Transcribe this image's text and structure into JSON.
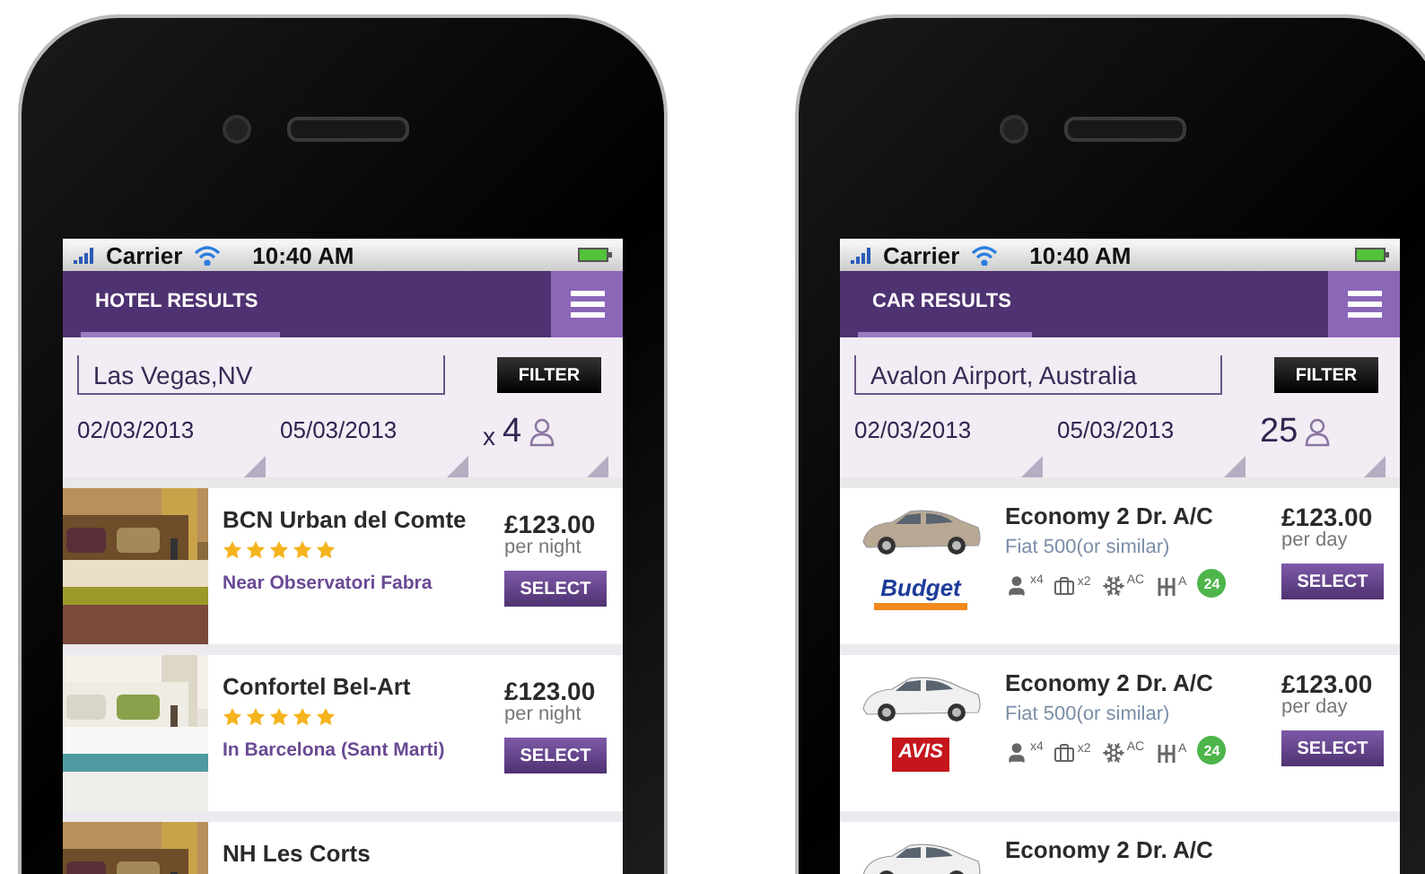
{
  "phones": [
    {
      "status_bar": {
        "carrier": "Carrier",
        "time": "10:40 AM"
      },
      "tab": {
        "label": "HOTEL RESULTS",
        "selected": true
      },
      "search": {
        "value": "Las Vegas,NV"
      },
      "filter_button": "FILTER",
      "dates": [
        "02/03/2013",
        "05/03/2013"
      ],
      "guests": {
        "prefix": "x",
        "count": "4"
      },
      "results": [
        {
          "kind": "hotel",
          "name": "BCN Urban del Comte",
          "stars": 5,
          "location": "Near Observatori Fabra",
          "price": "£123.00",
          "unit": "per night",
          "button": "SELECT"
        },
        {
          "kind": "hotel",
          "name": "Confortel Bel-Art",
          "stars": 5,
          "location": "In Barcelona (Sant Marti)",
          "price": "£123.00",
          "unit": "per night",
          "button": "SELECT"
        },
        {
          "kind": "hotel",
          "name": "NH Les Corts"
        }
      ]
    },
    {
      "status_bar": {
        "carrier": "Carrier",
        "time": "10:40 AM"
      },
      "tab": {
        "label": "CAR RESULTS",
        "selected": true
      },
      "search": {
        "value": "Avalon Airport, Australia"
      },
      "filter_button": "FILTER",
      "dates": [
        "02/03/2013",
        "05/03/2013"
      ],
      "guests": {
        "count": "25"
      },
      "results": [
        {
          "kind": "car",
          "name": "Economy 2 Dr. A/C",
          "model": "Fiat 500(or similar)",
          "logo": {
            "kind": "budget",
            "text": "Budget"
          },
          "features": [
            {
              "kind": "person",
              "label": "x4"
            },
            {
              "kind": "bag",
              "label": "x2"
            },
            {
              "kind": "ac",
              "label": "AC"
            },
            {
              "kind": "gear",
              "label": "A"
            }
          ],
          "badge": "24",
          "price": "£123.00",
          "unit": "per day",
          "button": "SELECT"
        },
        {
          "kind": "car",
          "name": "Economy 2 Dr. A/C",
          "model": "Fiat 500(or similar)",
          "logo": {
            "kind": "avis",
            "text": "AVIS"
          },
          "features": [
            {
              "kind": "person",
              "label": "x4"
            },
            {
              "kind": "bag",
              "label": "x2"
            },
            {
              "kind": "ac",
              "label": "AC"
            },
            {
              "kind": "gear",
              "label": "A"
            }
          ],
          "badge": "24",
          "price": "£123.00",
          "unit": "per day",
          "button": "SELECT"
        },
        {
          "kind": "car",
          "name": "Economy 2 Dr. A/C"
        }
      ]
    }
  ]
}
